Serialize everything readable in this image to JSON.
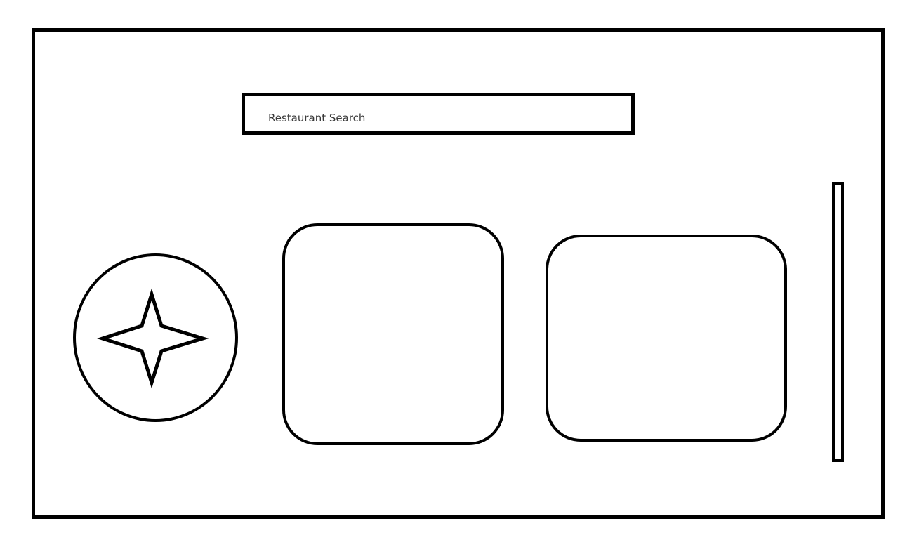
{
  "search": {
    "label": "Restaurant Search"
  },
  "fab": {
    "icon": "star-icon"
  },
  "cards": [
    {
      "title": ""
    },
    {
      "title": ""
    }
  ],
  "colors": {
    "stroke": "#000000",
    "background": "#ffffff",
    "text": "#3a3a3a"
  }
}
